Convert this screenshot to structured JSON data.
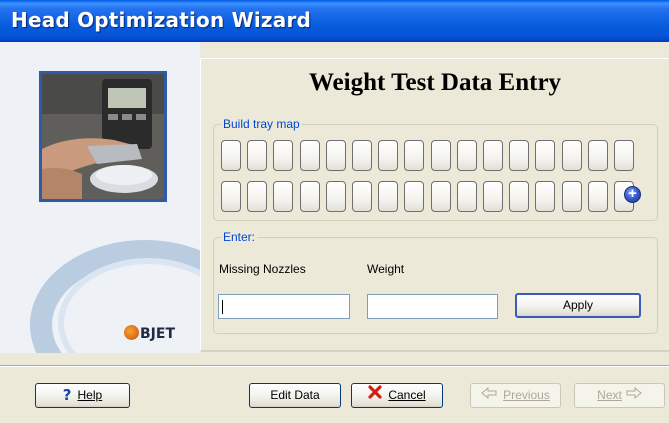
{
  "window": {
    "title": "Head Optimization Wizard"
  },
  "sidebar": {
    "logo_text": "BJET"
  },
  "page": {
    "title": "Weight Test Data Entry"
  },
  "tray_map": {
    "legend": "Build tray map",
    "rows": 2,
    "cols": 16,
    "add_icon": "plus-circle-icon"
  },
  "enter": {
    "legend": "Enter:",
    "missing_label": "Missing Nozzles",
    "weight_label": "Weight",
    "missing_value": "",
    "weight_value": "",
    "apply_label": "Apply"
  },
  "footer": {
    "help_label": "Help",
    "edit_label": "Edit Data",
    "cancel_label": "Cancel",
    "previous_label": "Previous",
    "next_label": "Next"
  },
  "colors": {
    "titlebar": "#0454d8",
    "group_legend": "#0046d5",
    "cancel_icon": "#d11f12",
    "help_icon": "#1546b8"
  }
}
